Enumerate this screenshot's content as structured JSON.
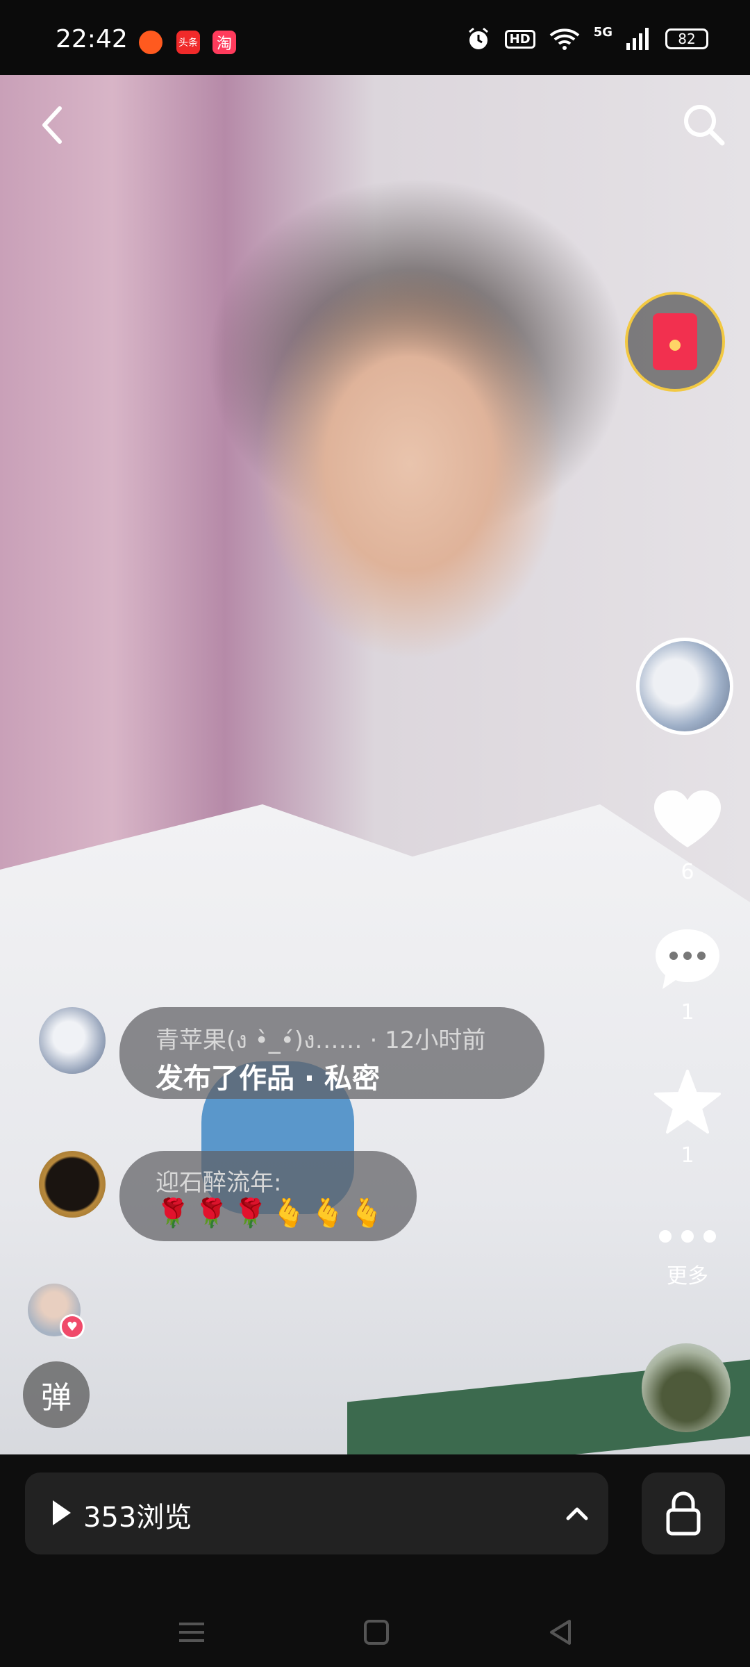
{
  "status_bar": {
    "time": "22:42",
    "notification_icons": [
      "huoshan-app-icon",
      "toutiao-app-icon",
      "taobao-app-icon"
    ],
    "toutiao_label": "头条",
    "taobao_label": "淘",
    "hd_label": "HD",
    "network_label": "5G",
    "battery": "82"
  },
  "video": {
    "author_avatar": "cats-avatar",
    "actions": {
      "like_count": "6",
      "comment_count": "1",
      "favorite_count": "1",
      "more_label": "更多"
    }
  },
  "comments": [
    {
      "user": "青苹果(ง •̀_•́)ง……",
      "time": "· 12小时前",
      "text": "发布了作品 · 私密"
    },
    {
      "user": "迎石醉流年:",
      "text": "🌹🌹🌹🫰🫰🫰"
    }
  ],
  "danmu_label": "弹",
  "bottom": {
    "views_label": "353浏览"
  },
  "colors": {
    "like_heart": "#ffffff",
    "red_packet": "#f2304f",
    "bubble": "rgba(95,95,100,0.72)"
  }
}
